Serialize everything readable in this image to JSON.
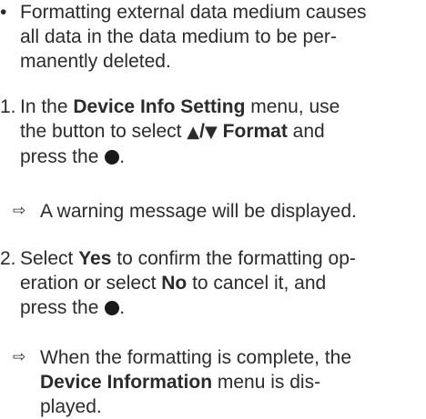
{
  "bullet": {
    "marker": "•",
    "line1": "Formatting external data medium causes",
    "line2": "all data in the data medium to be per-",
    "line3": "manently deleted."
  },
  "step1": {
    "number": "1.",
    "prefix": "In the ",
    "menu": "Device Info Setting",
    "line1_suffix": " menu, use",
    "line2_a": "the button to select ",
    "up_arrow": "▲",
    "slash": "/",
    "down_arrow": "▼",
    "format": " Format",
    "line2_b": " and",
    "line3": "press the ",
    "button_icon": "filled-circle-icon",
    "period": "."
  },
  "result1": {
    "marker": "⇨",
    "text": "A warning message will be displayed."
  },
  "step2": {
    "number": "2.",
    "select": "Select ",
    "yes": "Yes",
    "line1_suffix": " to confirm the formatting op-",
    "line2_a": "eration or select ",
    "no": "No",
    "line2_b": " to cancel it, and",
    "line3": "press the ",
    "button_icon": "filled-circle-icon",
    "period": "."
  },
  "result2": {
    "marker": "⇨",
    "line1": "When the formatting is complete, the",
    "menu": "Device Information",
    "line2_suffix": " menu is dis-",
    "line3": "played."
  }
}
